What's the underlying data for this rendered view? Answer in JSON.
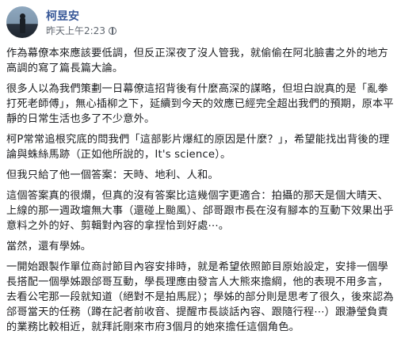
{
  "post": {
    "author": "柯昱安",
    "timestamp": "昨天上午2:23",
    "privacy_icon": "globe-icon",
    "paragraphs": [
      "作為幕僚本來應該要低調，但反正深夜了沒人管我，就偷偷在阿北臉書之外的地方高調的寫了篇長篇大論。",
      "很多人以為我們策劃一日幕僚這招背後有什麼高深的謀略，但坦白說真的是「亂拳打死老師傅」，無心插柳之下，延續到今天的效應已經完全超出我們的預期，原本平靜的日常生活也多了不少意外。",
      "柯P常常追根究底的問我們「這部影片爆紅的原因是什麼？」，希望能找出背後的理論與蛛絲馬跡（正如他所說的，It's science）。",
      "但我只給了他一個答案：天時、地利、人和。",
      "這個答案真的很爛，但真的沒有答案比這幾個字更適合：拍攝的那天是個大晴天、上線的那一週政壇無大事（還碰上颱風）、郃哥跟市長在沒有腳本的互動下效果出乎意料之外的好、剪輯對內容的拿捏恰到好處⋯。",
      "當然，還有學姊。",
      "一開始跟製作單位商討節目內容安排時，就是希望依照節目原始設定，安排一個學長搭配一個學姊跟郃哥互動，學長理應由發言人大熊來擔綱，他的表現不用多言，去看公宅那一段就知道（絕對不是拍馬屁）；學姊的部分則是思考了很久，後來認為郃哥當天的任務（蹲在記者前收音、提醒市長談話內容、跟隨行程⋯）跟瀞瑩負責的業務比較相近，就拜託剛來市府3個月的她來擔任這個角色。"
    ]
  }
}
